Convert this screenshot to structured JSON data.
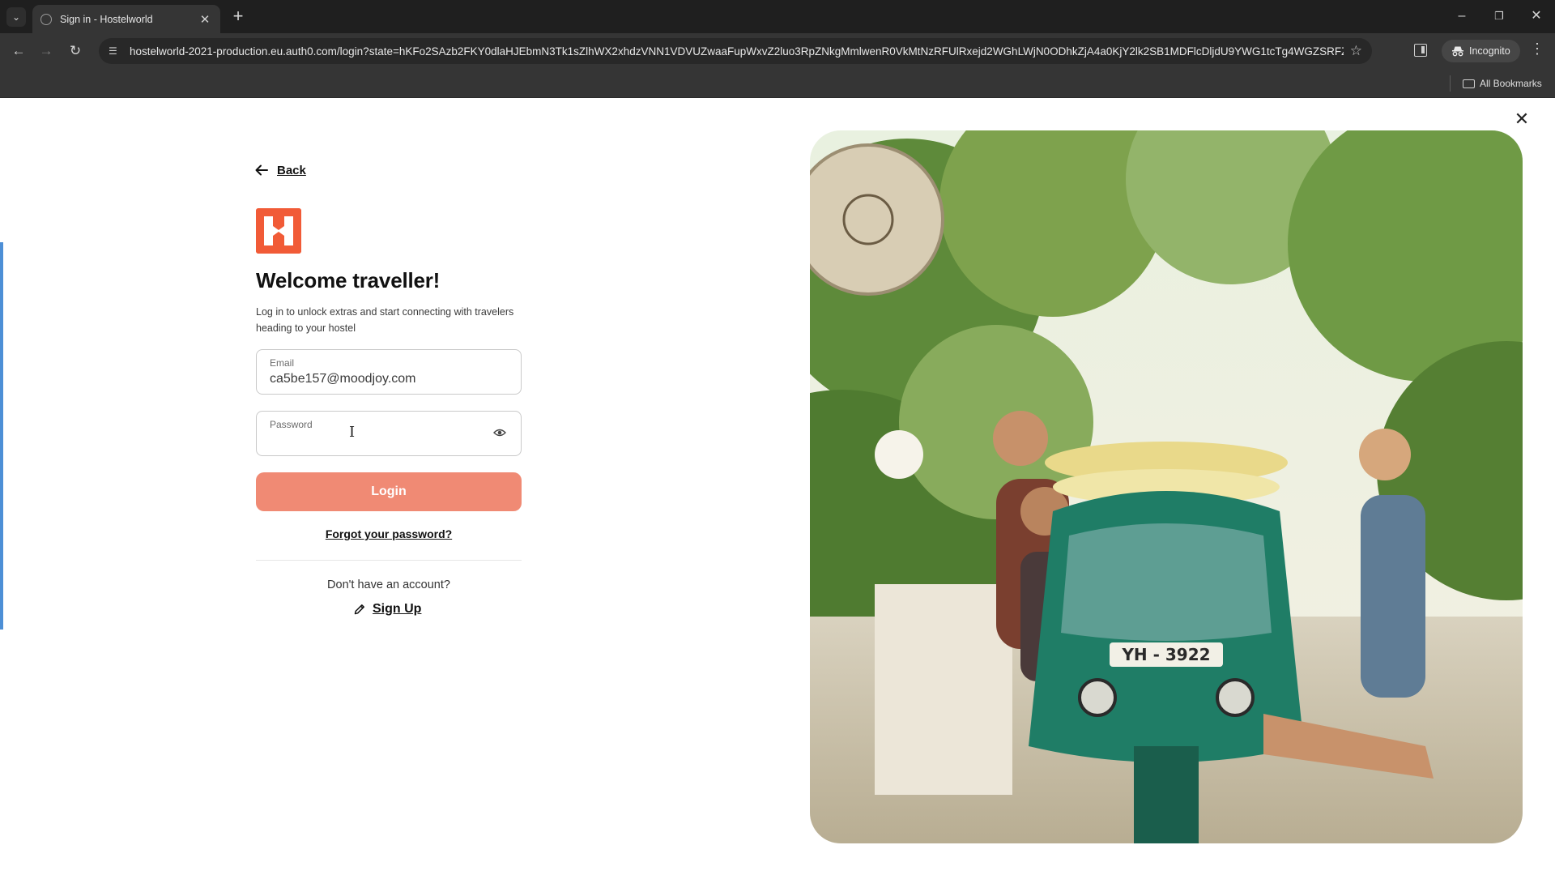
{
  "browser": {
    "tab_title": "Sign in - Hostelworld",
    "url": "hostelworld-2021-production.eu.auth0.com/login?state=hKFo2SAzb2FKY0dlaHJEbmN3Tk1sZlhWX2xhdzVNN1VDVUZwaaFupWxvZ2luo3RpZNkgMmlwenR0VkMtNzRFUlRxejd2WGhLWjN0ODhkZjA4a0KjY2lk2SB1MDFlcDljdU9YWG1tcTg4WGZSRFZa...",
    "incognito_label": "Incognito",
    "bookmarks_label": "All Bookmarks"
  },
  "login": {
    "back_label": "Back",
    "heading": "Welcome traveller!",
    "subtitle": "Log in to unlock extras and start connecting with travelers heading to your hostel",
    "email_label": "Email",
    "email_value": "ca5be157@moodjoy.com",
    "password_label": "Password",
    "password_value": "",
    "login_button": "Login",
    "forgot_link": "Forgot your password?",
    "no_account_text": "Don't have an account?",
    "signup_link": "Sign Up"
  },
  "colors": {
    "brand": "#f15b37",
    "login_button": "#f08a74"
  },
  "icons": {
    "back": "arrow-left-icon",
    "logo": "hostelworld-logo",
    "password_toggle": "eye-icon",
    "signup": "pencil-icon",
    "close": "close-icon"
  }
}
